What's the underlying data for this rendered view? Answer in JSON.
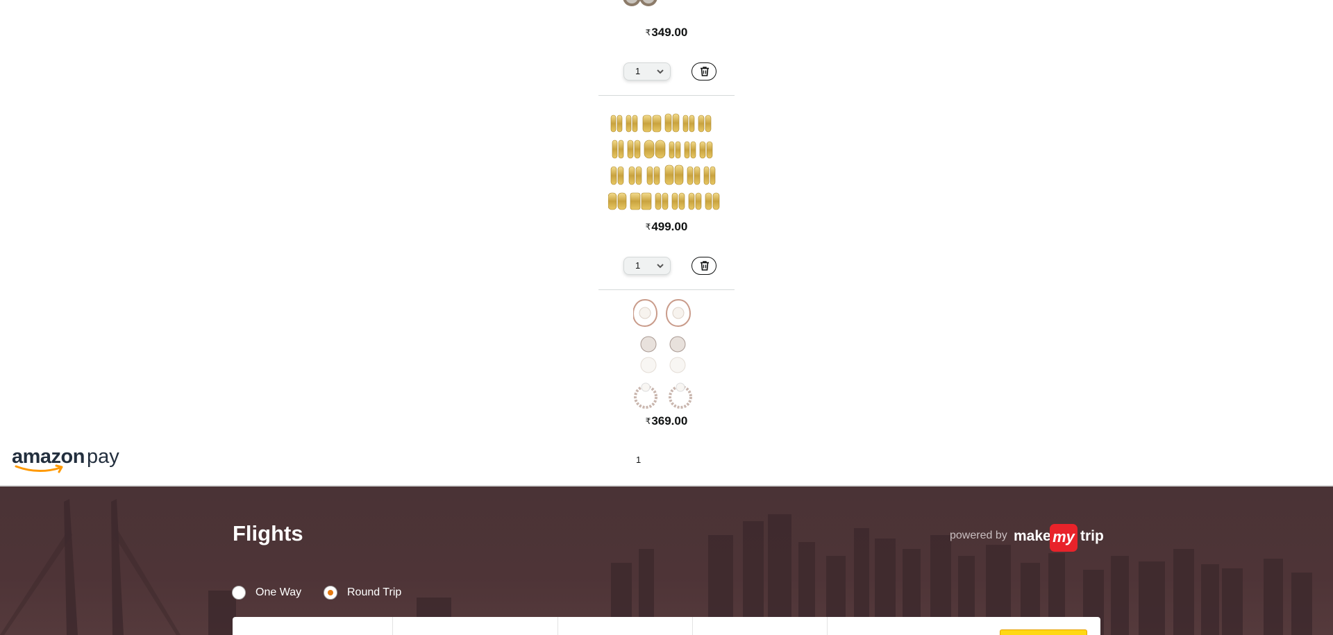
{
  "cart": {
    "items": [
      {
        "price": "349.00",
        "currency": "₹",
        "quantity": "1"
      },
      {
        "price": "499.00",
        "currency": "₹",
        "quantity": "1"
      },
      {
        "price": "369.00",
        "currency": "₹",
        "quantity": "1"
      }
    ]
  },
  "amazon_pay": {
    "word1": "amazon",
    "word2": "pay"
  },
  "flights": {
    "title": "Flights",
    "powered_by": "powered by",
    "brand": {
      "make": "make",
      "my": "my",
      "trip": "trip"
    },
    "trip_types": [
      {
        "label": "One Way",
        "selected": false
      },
      {
        "label": "Round Trip",
        "selected": true
      }
    ]
  },
  "colors": {
    "accent": "#e47911",
    "mmt_red": "#e8232a",
    "flights_bg": "#4e3437",
    "search_button": "#ffd814"
  }
}
